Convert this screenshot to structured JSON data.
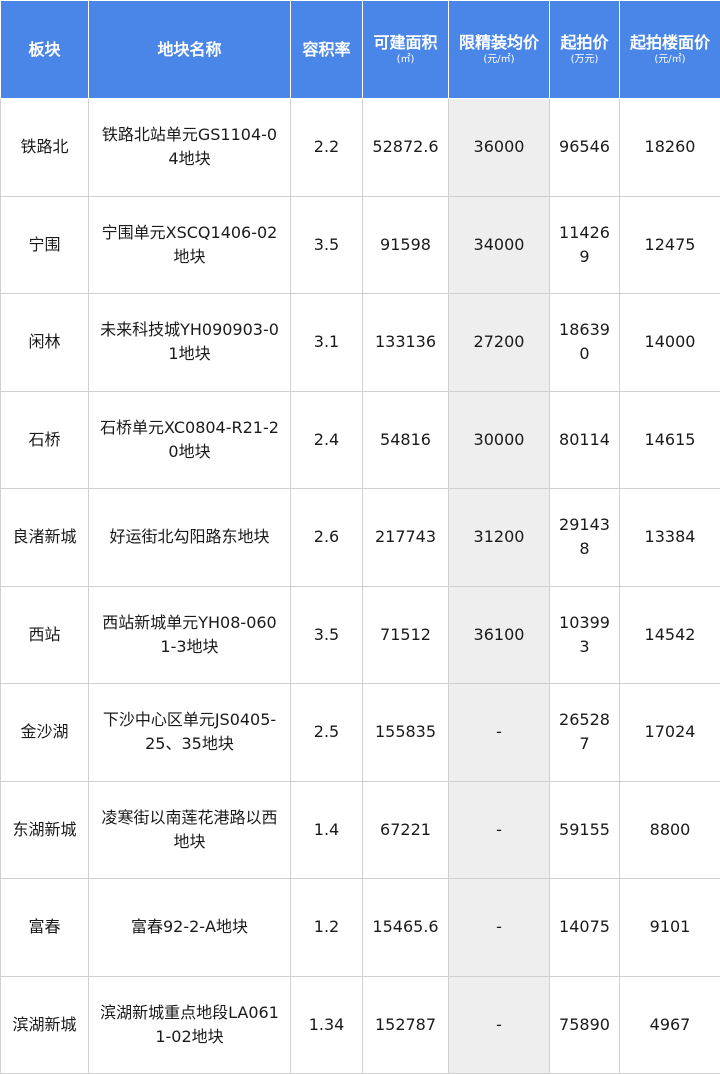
{
  "table": {
    "headers": [
      {
        "label": "板块",
        "unit": ""
      },
      {
        "label": "地块名称",
        "unit": ""
      },
      {
        "label": "容积率",
        "unit": ""
      },
      {
        "label": "可建面积",
        "unit": "(㎡)"
      },
      {
        "label": "限精装均价",
        "unit": "(元/㎡)"
      },
      {
        "label": "起拍价",
        "unit": "(万元)"
      },
      {
        "label": "起拍楼面价",
        "unit": "(元/㎡)"
      }
    ],
    "rows": [
      [
        "铁路北",
        "铁路北站单元GS1104-04地块",
        "2.2",
        "52872.6",
        "36000",
        "96546",
        "18260"
      ],
      [
        "宁围",
        "宁围单元XSCQ1406-02地块",
        "3.5",
        "91598",
        "34000",
        "114269",
        "12475"
      ],
      [
        "闲林",
        "未来科技城YH090903-01地块",
        "3.1",
        "133136",
        "27200",
        "186390",
        "14000"
      ],
      [
        "石桥",
        "石桥单元XC0804-R21-20地块",
        "2.4",
        "54816",
        "30000",
        "80114",
        "14615"
      ],
      [
        "良渚新城",
        "好运街北勾阳路东地块",
        "2.6",
        "217743",
        "31200",
        "291438",
        "13384"
      ],
      [
        "西站",
        "西站新城单元YH08-0601-3地块",
        "3.5",
        "71512",
        "36100",
        "103993",
        "14542"
      ],
      [
        "金沙湖",
        "下沙中心区单元JS0405-25、35地块",
        "2.5",
        "155835",
        "-",
        "265287",
        "17024"
      ],
      [
        "东湖新城",
        "凌寒街以南莲花港路以西地块",
        "1.4",
        "67221",
        "-",
        "59155",
        "8800"
      ],
      [
        "富春",
        "富春92-2-A地块",
        "1.2",
        "15465.6",
        "-",
        "14075",
        "9101"
      ],
      [
        "滨湖新城",
        "滨湖新城重点地段LA0611-02地块",
        "1.34",
        "152787",
        "-",
        "75890",
        "4967"
      ]
    ]
  },
  "colors": {
    "header_bg": "#4a86e8",
    "header_text": "#ffffff",
    "price_col_bg": "#eeeeee",
    "border": "#d0d0d0"
  }
}
